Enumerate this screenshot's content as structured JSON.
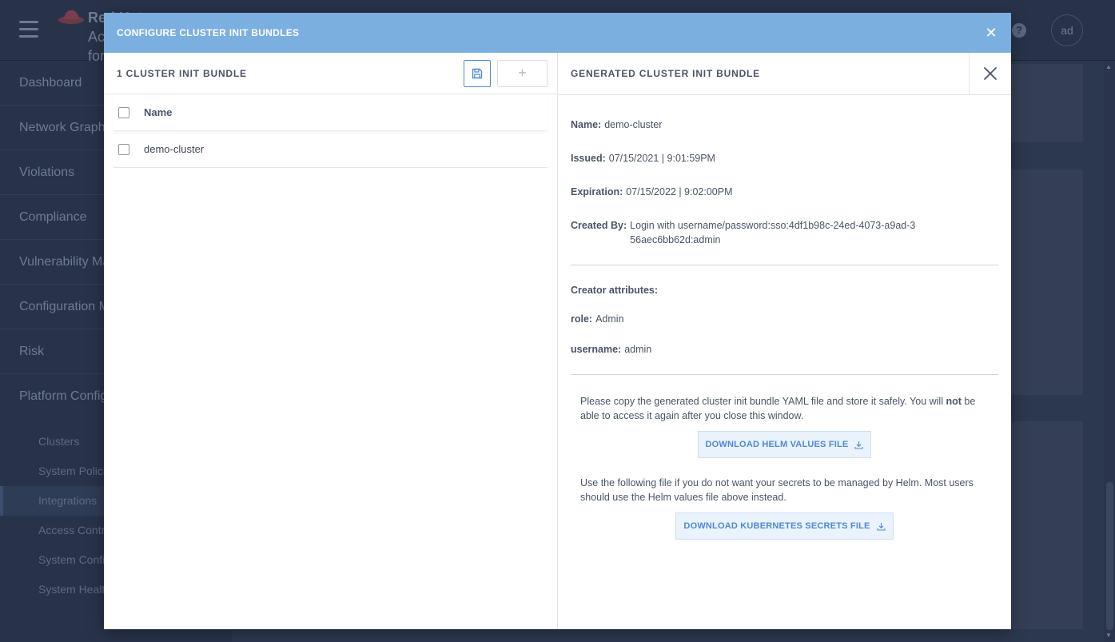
{
  "app": {
    "brand_line1": "Red Hat",
    "brand_line2": "Ac",
    "brand_line3": "for",
    "avatar_initials": "ad"
  },
  "sidebar": {
    "items": [
      {
        "label": "Dashboard"
      },
      {
        "label": "Network Graph"
      },
      {
        "label": "Violations"
      },
      {
        "label": "Compliance"
      },
      {
        "label": "Vulnerability Management"
      },
      {
        "label": "Configuration Management"
      },
      {
        "label": "Risk"
      },
      {
        "label": "Platform Configuration"
      }
    ],
    "sub_items": [
      {
        "label": "Clusters"
      },
      {
        "label": "System Policies"
      },
      {
        "label": "Integrations"
      },
      {
        "label": "Access Control"
      },
      {
        "label": "System Configuration"
      },
      {
        "label": "System Health"
      }
    ]
  },
  "modal": {
    "title": "CONFIGURE CLUSTER INIT BUNDLES",
    "close_icon": "close-icon"
  },
  "list": {
    "title": "1 CLUSTER INIT BUNDLE",
    "add_label": "+",
    "column_name": "Name",
    "rows": [
      {
        "name": "demo-cluster"
      }
    ]
  },
  "details": {
    "title": "GENERATED CLUSTER INIT BUNDLE",
    "name_label": "Name:",
    "name_value": "demo-cluster",
    "issued_label": "Issued:",
    "issued_value": "07/15/2021 | 9:01:59PM",
    "expiration_label": "Expiration:",
    "expiration_value": "07/15/2022 | 9:02:00PM",
    "created_by_label": "Created By:",
    "created_by_value": "Login with username/password:sso:4df1b98c-24ed-4073-a9ad-356aec6bb62d:admin",
    "creator_attributes_label": "Creator attributes:",
    "role_label": "role:",
    "role_value": "Admin",
    "username_label": "username:",
    "username_value": "admin",
    "notice_prefix": "Please copy the generated cluster init bundle YAML file and store it safely. You will",
    "notice_bold": "not",
    "notice_suffix": "be able to access it again after you close this window.",
    "download_helm_label": "DOWNLOAD HELM VALUES FILE",
    "secrets_notice": "Use the following file if you do not want your secrets to be managed by Helm. Most users should use the Helm values file above instead.",
    "download_k8s_label": "DOWNLOAD KUBERNETES SECRETS FILE"
  },
  "colors": {
    "modal_header": "#7aafe0",
    "accent": "#4f8ad6",
    "background_app": "#28334a"
  }
}
